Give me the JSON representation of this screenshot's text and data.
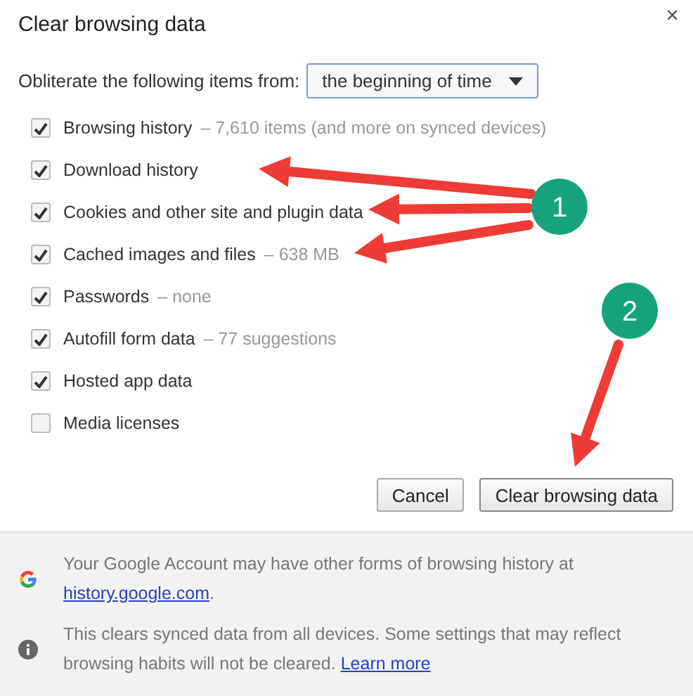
{
  "dialog": {
    "title": "Clear browsing data",
    "close": "×"
  },
  "range": {
    "label": "Obliterate the following items from:",
    "value": "the beginning of time"
  },
  "items": [
    {
      "label": "Browsing history",
      "detail": "– 7,610 items (and more on synced devices)",
      "checked": true
    },
    {
      "label": "Download history",
      "checked": true
    },
    {
      "label": "Cookies and other site and plugin data",
      "checked": true
    },
    {
      "label": "Cached images and files",
      "detail": "– 638 MB",
      "checked": true
    },
    {
      "label": "Passwords",
      "detail": "– none",
      "checked": true
    },
    {
      "label": "Autofill form data",
      "detail": "– 77 suggestions",
      "checked": true
    },
    {
      "label": "Hosted app data",
      "checked": true
    },
    {
      "label": "Media licenses",
      "checked": false
    }
  ],
  "buttons": [
    {
      "label": "Cancel",
      "kind": "secondary"
    },
    {
      "label": "Clear browsing data",
      "kind": "primary"
    }
  ],
  "footer": [
    {
      "kind": "google",
      "text": "Your Google Account may have other forms of browsing history at",
      "link": "history.google.com",
      "after": "."
    },
    {
      "kind": "info",
      "text": "This clears synced data from all devices. Some settings that may reflect browsing habits will not be cleared.",
      "link": "Learn more"
    }
  ],
  "annotations": [
    {
      "number": "1"
    },
    {
      "number": "2"
    }
  ]
}
